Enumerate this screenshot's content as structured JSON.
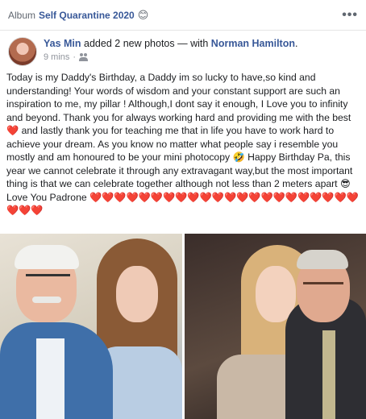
{
  "album": {
    "label": "Album",
    "name": "Self Quarantine 2020",
    "emoji": "😊",
    "more": "•••"
  },
  "post": {
    "author": "Yas Min",
    "action": "added 2 new photos — with",
    "tagged": "Norman Hamilton",
    "tagged_suffix": ".",
    "time": "9 mins",
    "separator": "·",
    "audience_icon": "friends-icon"
  },
  "body": {
    "p1": "Today is my Daddy's Birthday, a Daddy im so lucky to have,so kind and understanding! Your words of wisdom and your constant support are such an inspiration to me, my pillar ! Although,I dont say it enough, I Love you to infinity and beyond. Thank you for always working hard and providing me with the best",
    "heart_single": "❤️",
    "p2": "and lastly thank you for teaching me that in life you have to work hard to achieve your dream. As you know no matter what people say i resemble you mostly and am honoured to be your mini photocopy",
    "emoji_rofl": "🤣",
    "p3": "Happy Birthday Pa, this year we cannot celebrate it through any extravagant way,but the most important thing is that we can celebrate together although not less than 2 meters apart",
    "emoji_cool": "😎",
    "p4": "Love You Padrone",
    "hearts_row": "❤️❤️❤️❤️❤️❤️❤️❤️❤️❤️❤️❤️❤️❤️❤️❤️❤️❤️❤️❤️❤️❤️❤️❤️❤️"
  },
  "photos": [
    {
      "description_icon": "photo-left"
    },
    {
      "description_icon": "photo-right"
    }
  ]
}
